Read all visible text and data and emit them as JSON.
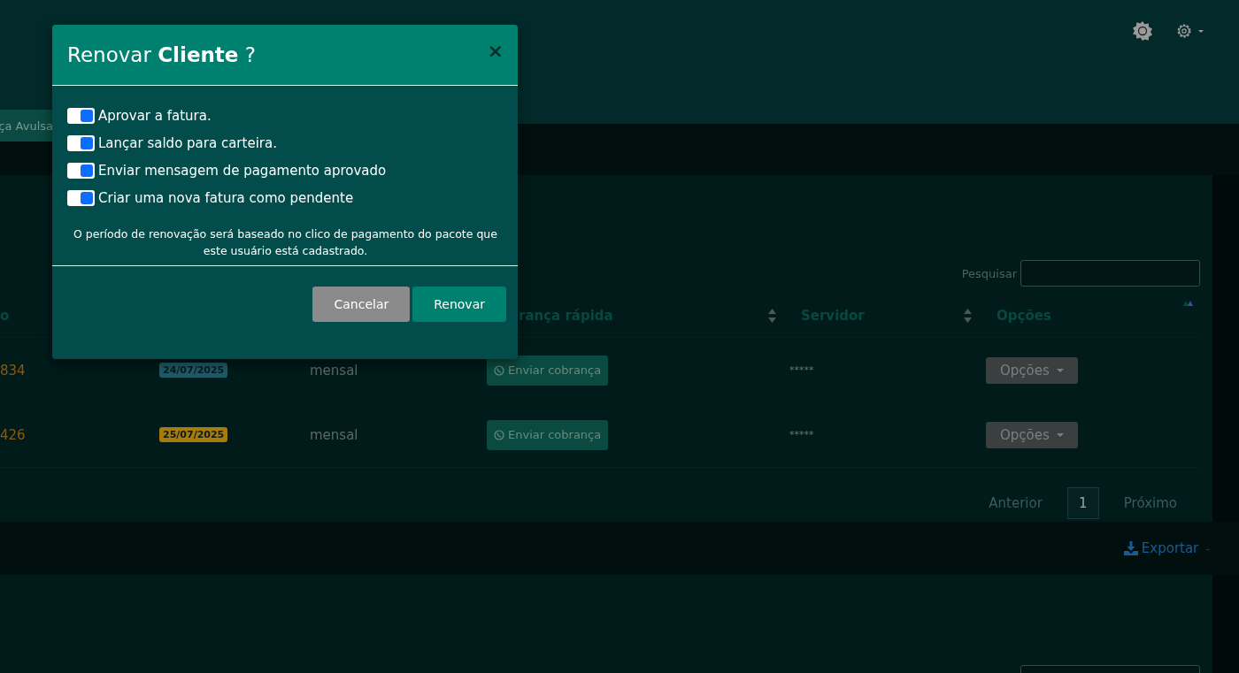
{
  "toolbar": {
    "button": "ça Avulsa"
  },
  "table": {
    "search": {
      "label": "Pesquisar"
    },
    "columns": [
      {
        "label": "o"
      },
      {
        "label": "rança rápida",
        "sorted": false
      },
      {
        "label": "Servidor",
        "sorted": false
      },
      {
        "label": "Opções",
        "sorted": true
      }
    ],
    "rows": [
      {
        "id": "834",
        "due": "24/07/2025",
        "color": "#1f5a66",
        "plan": "mensal",
        "charge": "Enviar cobrança",
        "server": "*****",
        "options": "Opções"
      },
      {
        "id": "426",
        "due": "25/07/2025",
        "color": "#a67c0c",
        "plan": "mensal",
        "charge": "Enviar cobrança",
        "server": "*****",
        "options": "Opções"
      }
    ],
    "pagination": {
      "prev": "Anterior",
      "pages": [
        {
          "label": "1",
          "selected": true
        }
      ],
      "next": "Próximo"
    }
  },
  "export": {
    "label": "Exportar",
    "separator": "-"
  },
  "modal": {
    "title": "Renovar **Cliente** ?",
    "close": "×",
    "options": [
      {
        "label": "Aprovar a fatura.",
        "checked": true
      },
      {
        "label": "Lançar saldo para carteira.",
        "checked": true
      },
      {
        "label": "Enviar mensagem de pagamento aprovado",
        "checked": true
      },
      {
        "label": "Criar uma nova fatura como pendente",
        "checked": true
      }
    ],
    "note": "O período de renovação será baseado no clico de pagamento do pacote que este usuário está cadastrado.",
    "buttons": [
      {
        "label": "Cancelar",
        "kind": "secondary"
      },
      {
        "label": "Renovar",
        "kind": "primary"
      }
    ]
  }
}
